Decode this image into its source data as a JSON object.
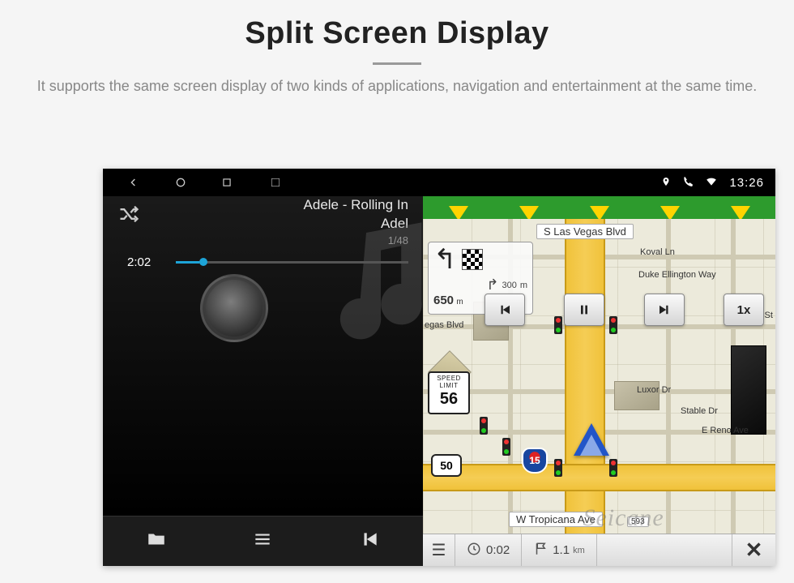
{
  "page": {
    "title": "Split Screen Display",
    "subtitle": "It supports the same screen display of two kinds of applications, navigation and entertainment at the same time."
  },
  "status": {
    "time": "13:26"
  },
  "music": {
    "track_title": "Adele - Rolling In",
    "artist": "Adel",
    "track_index": "1/48",
    "elapsed": "2:02"
  },
  "navigation": {
    "top_street": "S Las Vegas Blvd",
    "street_duke": "Duke Ellington Way",
    "street_vegas": "egas Blvd",
    "street_koval": "Koval Ln",
    "street_luxor": "Luxor Dr",
    "street_reno": "E Reno Ave",
    "street_stable": "Stable Dr",
    "street_miles": "iles St",
    "street_tropicana": "W Tropicana Ave",
    "street_tropicana_num": "593",
    "turn_distance": "650",
    "turn_distance_unit": "m",
    "next_turn_distance": "300",
    "next_turn_distance_unit": "m",
    "speed_limit_label1": "SPEED",
    "speed_limit_label2": "LIMIT",
    "speed_limit_value": "56",
    "route_number": "50",
    "interstate_number": "15",
    "sim_speed": "1x",
    "bottom_time": "0:02",
    "bottom_dist": "1.1",
    "bottom_dist_unit": "km"
  },
  "watermark": "Seicane"
}
